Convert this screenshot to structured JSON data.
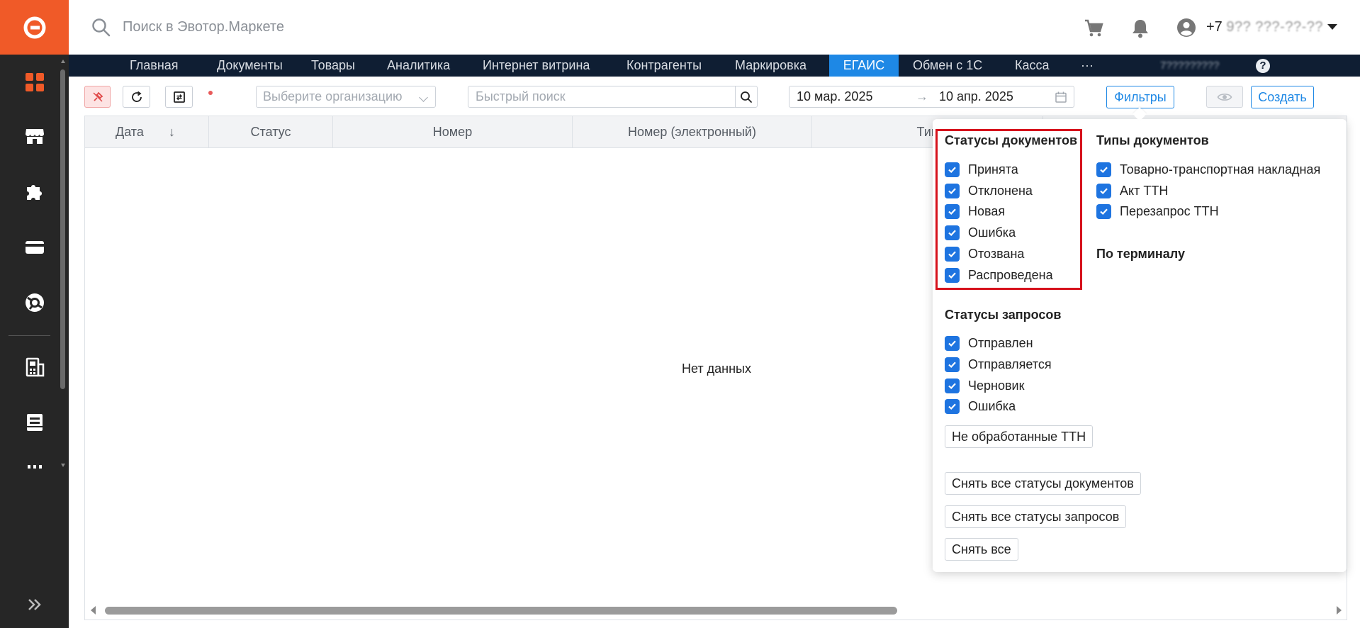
{
  "search": {
    "placeholder": "Поиск в Эвотор.Маркете"
  },
  "user": {
    "phone_prefix": "+7",
    "phone_masked": "9?? ???-??-??"
  },
  "nav": {
    "items": [
      {
        "label": "Главная"
      },
      {
        "label": "Документы"
      },
      {
        "label": "Товары"
      },
      {
        "label": "Аналитика"
      },
      {
        "label": "Интернет витрина"
      },
      {
        "label": "Контрагенты"
      },
      {
        "label": "Маркировка"
      },
      {
        "label": "ЕГАИС"
      },
      {
        "label": "Обмен с 1С"
      },
      {
        "label": "Касса"
      },
      {
        "label": "···"
      }
    ],
    "active": "ЕГАИС",
    "org_masked": "7?????????",
    "help": "?"
  },
  "toolbar": {
    "org_placeholder": "Выберите организацию",
    "quick_search_placeholder": "Быстрый поиск",
    "date_from": "10 мар. 2025",
    "date_arrow": "→",
    "date_to": "10 апр. 2025",
    "filters_label": "Фильтры",
    "create_label": "Создать"
  },
  "table": {
    "columns": [
      "Дата",
      "Статус",
      "Номер",
      "Номер (электронный)",
      "Тип"
    ],
    "sort_indicator": "↓",
    "empty_text": "Нет данных"
  },
  "filters": {
    "doc_statuses": {
      "title": "Статусы документов",
      "items": [
        {
          "label": "Принята",
          "checked": true
        },
        {
          "label": "Отклонена",
          "checked": true
        },
        {
          "label": "Новая",
          "checked": true
        },
        {
          "label": "Ошибка",
          "checked": true
        },
        {
          "label": "Отозвана",
          "checked": true
        },
        {
          "label": "Распроведена",
          "checked": true
        }
      ]
    },
    "doc_types": {
      "title": "Типы документов",
      "items": [
        {
          "label": "Товарно-транспортная накладная",
          "checked": true
        },
        {
          "label": "Акт ТТН",
          "checked": true
        },
        {
          "label": "Перезапрос ТТН",
          "checked": true
        }
      ]
    },
    "terminal_title": "По терминалу",
    "request_statuses": {
      "title": "Статусы запросов",
      "items": [
        {
          "label": "Отправлен",
          "checked": true
        },
        {
          "label": "Отправляется",
          "checked": true
        },
        {
          "label": "Черновик",
          "checked": true
        },
        {
          "label": "Ошибка",
          "checked": true
        }
      ]
    },
    "unprocessed_btn": "Не обработанные ТТН",
    "clear_doc_btn": "Снять все статусы документов",
    "clear_req_btn": "Снять все статусы запросов",
    "clear_all_btn": "Снять все"
  },
  "colors": {
    "brand": "#f05a28",
    "sidebar": "#262626",
    "navbar": "#0f1e33",
    "accent": "#1e88e5",
    "highlight_border": "#d6121c"
  }
}
